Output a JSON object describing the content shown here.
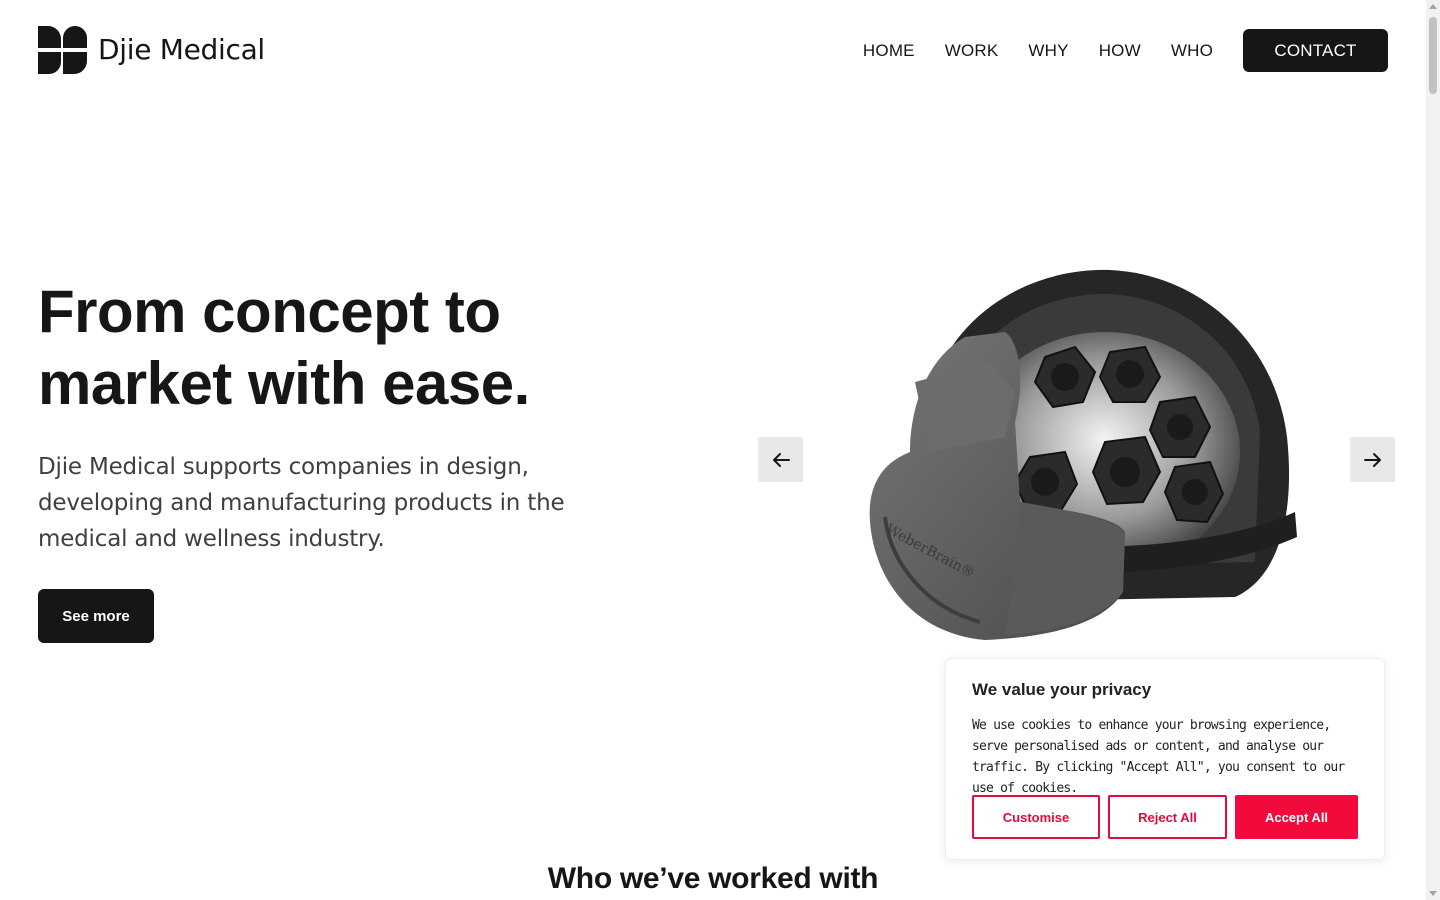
{
  "brand": {
    "name": "Djie Medical"
  },
  "nav": {
    "items": [
      {
        "label": "HOME"
      },
      {
        "label": "WORK"
      },
      {
        "label": "WHY"
      },
      {
        "label": "HOW"
      },
      {
        "label": "WHO"
      }
    ],
    "contact_label": "CONTACT"
  },
  "hero": {
    "title_line1": "From concept to",
    "title_line2": "market with ease.",
    "subtitle": "Djie Medical supports companies in design, developing and manufacturing products in the medical and wellness industry.",
    "cta_label": "See more"
  },
  "carousel": {
    "prev_icon": "arrow-left-icon",
    "next_icon": "arrow-right-icon",
    "image_label": "WeberBrain®"
  },
  "section": {
    "title": "Who we’ve worked with"
  },
  "cookie": {
    "title": "We value your privacy",
    "text": "We use cookies to enhance your browsing experience, serve personalised ads or content, and analyse our traffic. By clicking \"Accept All\", you consent to our use of cookies.",
    "customise_label": "Customise",
    "reject_label": "Reject All",
    "accept_label": "Accept All"
  },
  "colors": {
    "ink": "#161616",
    "accent_red": "#f20a3c",
    "arrow_bg": "#e8e8e8"
  }
}
